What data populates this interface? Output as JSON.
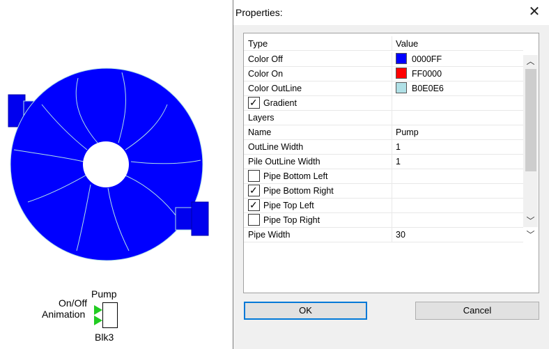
{
  "canvas": {
    "block": {
      "title": "Pump",
      "input_labels": [
        "On/Off",
        "Animation"
      ],
      "name": "Blk3"
    },
    "pump_colors": {
      "body": "#0000FF",
      "outline": "#B0E0E6",
      "hub": "#FFFFFF"
    }
  },
  "dialog": {
    "title": "Properties:",
    "close_label": "✕",
    "columns": {
      "type": "Type",
      "value": "Value"
    },
    "rows": [
      {
        "label": "Color Off",
        "value": "0000FF",
        "swatch": "#0000FF"
      },
      {
        "label": "Color On",
        "value": "FF0000",
        "swatch": "#FF0000"
      },
      {
        "label": "Color OutLine",
        "value": "B0E0E6",
        "swatch": "#B0E0E6"
      },
      {
        "label": "Gradient",
        "checked": true
      },
      {
        "label": "Layers",
        "value": ""
      },
      {
        "label": "Name",
        "value": "Pump"
      },
      {
        "label": "OutLine Width",
        "value": "1"
      },
      {
        "label": "Pile OutLine Width",
        "value": "1"
      },
      {
        "label": "Pipe Bottom Left",
        "checked": false
      },
      {
        "label": "Pipe Bottom Right",
        "checked": true
      },
      {
        "label": "Pipe Top Left",
        "checked": true
      },
      {
        "label": "Pipe Top Right",
        "checked": false
      },
      {
        "label": "Pipe Width",
        "value": "30"
      }
    ],
    "scroll_up_icon": "chevron-up",
    "scroll_down_icon": "chevron-down",
    "ok_label": "OK",
    "cancel_label": "Cancel"
  }
}
